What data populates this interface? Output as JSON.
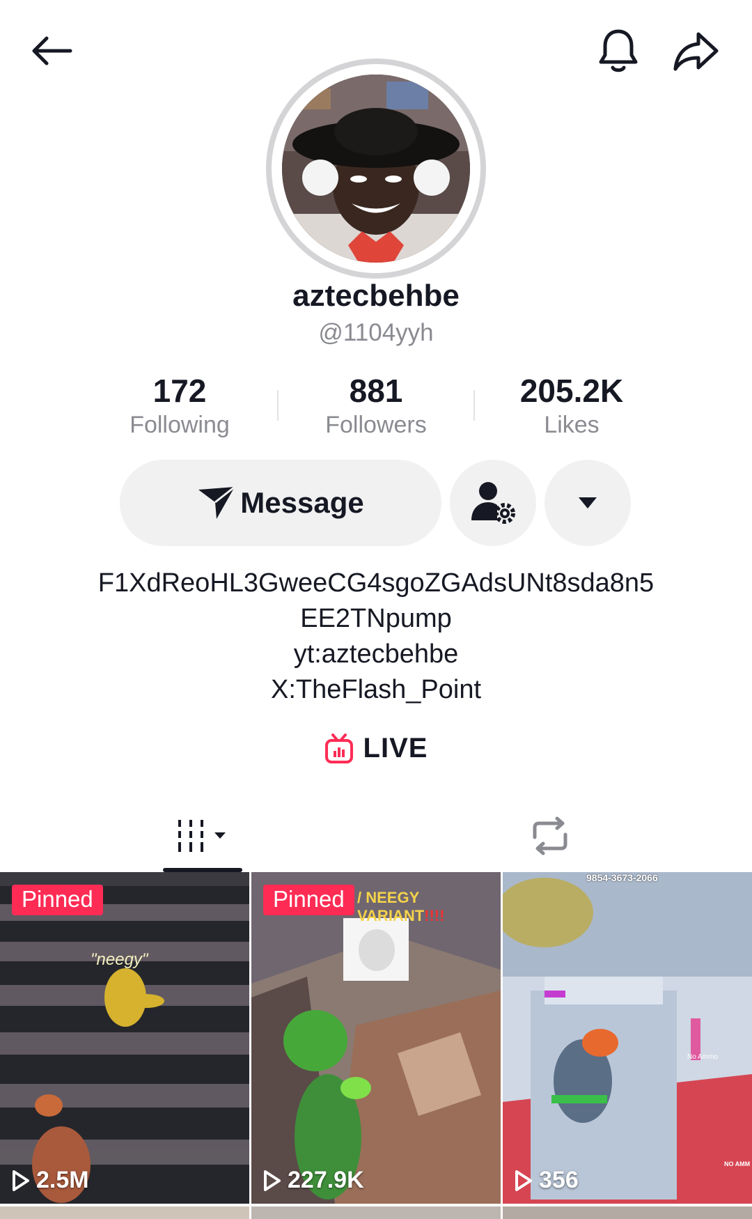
{
  "profile": {
    "display_name": "aztecbehbe",
    "handle": "@1104yyh"
  },
  "stats": {
    "following": {
      "value": "172",
      "label": "Following"
    },
    "followers": {
      "value": "881",
      "label": "Followers"
    },
    "likes": {
      "value": "205.2K",
      "label": "Likes"
    }
  },
  "actions": {
    "message_label": "Message"
  },
  "bio": {
    "lines": [
      "F1XdReoHL3GweeCG4sgoZGAdsUNt8sda8n5",
      "EE2TNpump",
      "yt:aztecbehbe",
      "X:TheFlash_Point"
    ]
  },
  "live": {
    "label": "LIVE"
  },
  "colors": {
    "accent": "#fe2c55",
    "text": "#161823",
    "secondary": "#8a8b91",
    "button_bg": "#f1f1f2"
  },
  "icons": {
    "back": "back-arrow-icon",
    "bell": "bell-icon",
    "share": "share-icon",
    "send": "send-icon",
    "user_settings": "user-settings-icon",
    "dropdown": "caret-down-icon",
    "live": "tv-live-icon",
    "grid": "videos-grid-icon",
    "repost": "repost-icon",
    "play": "play-icon"
  },
  "videos": [
    {
      "pinned_label": "Pinned",
      "views": "2.5M",
      "caption": "\"neegy\""
    },
    {
      "pinned_label": "Pinned",
      "views": "227.9K",
      "caption_line1": "/ NEEGY",
      "caption_line2": "VARIANT",
      "caption_marks": "!!!!"
    },
    {
      "views": "356",
      "code": "9854-3673-2066",
      "side_text": "No Ammo",
      "corner_text": "NO AMM"
    }
  ]
}
